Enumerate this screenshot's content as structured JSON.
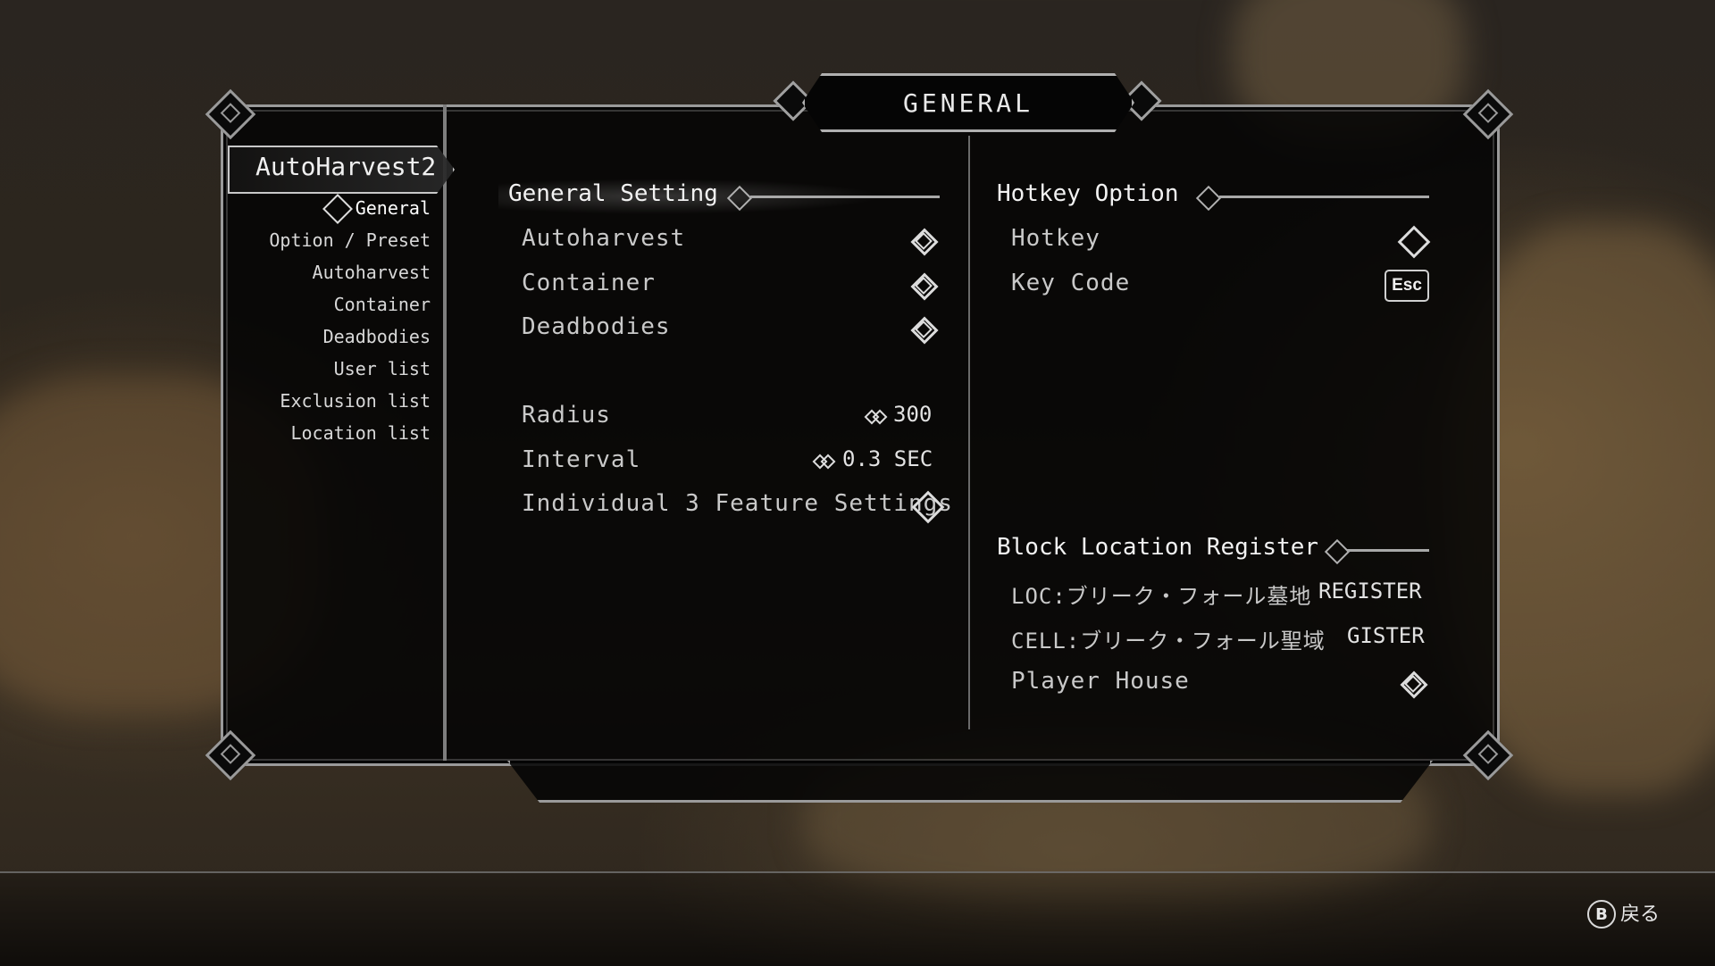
{
  "window": {
    "title": "GENERAL"
  },
  "mod": {
    "name": "AutoHarvest2"
  },
  "sidebar": {
    "items": [
      {
        "label": "General",
        "active": true
      },
      {
        "label": "Option / Preset"
      },
      {
        "label": "Autoharvest"
      },
      {
        "label": "Container"
      },
      {
        "label": "Deadbodies"
      },
      {
        "label": "User list"
      },
      {
        "label": "Exclusion list"
      },
      {
        "label": "Location list"
      }
    ]
  },
  "general_setting": {
    "header": "General Setting",
    "toggles": [
      {
        "label": "Autoharvest",
        "icon": "checked-knot-icon"
      },
      {
        "label": "Container",
        "icon": "checked-knot-icon"
      },
      {
        "label": "Deadbodies",
        "icon": "checked-knot-icon"
      }
    ],
    "radius": {
      "label": "Radius",
      "value": "300"
    },
    "interval": {
      "label": "Interval",
      "value": "0.3 SEC"
    },
    "individual": {
      "label": "Individual 3 Feature Settings",
      "icon": "diamond-icon"
    }
  },
  "hotkey_option": {
    "header": "Hotkey Option",
    "hotkey": {
      "label": "Hotkey",
      "icon": "diamond-icon"
    },
    "key_code": {
      "label": "Key Code",
      "value": "Esc"
    }
  },
  "block_location": {
    "header": "Block Location Register",
    "loc": {
      "label": "LOC:ブリーク・フォール墓地",
      "value": "REGISTER"
    },
    "cell": {
      "label": "CELL:ブリーク・フォール聖域",
      "value": "GISTER"
    },
    "player_house": {
      "label": "Player House",
      "icon": "checked-knot-icon"
    }
  },
  "footer": {
    "back_button": "B",
    "back_label": "戻る"
  },
  "colors": {
    "frame": "#9a9a9a",
    "panel": "#050505",
    "text": "#cfcfcf"
  }
}
